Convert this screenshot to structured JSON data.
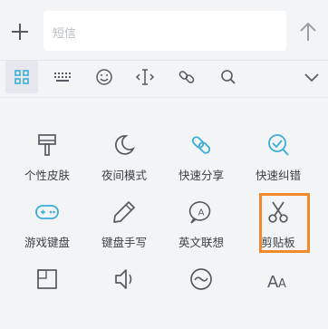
{
  "input": {
    "placeholder": "短信"
  },
  "toolbar": {
    "tools": [
      {
        "icon": "grid-icon",
        "active": true
      },
      {
        "icon": "keyboard-icon"
      },
      {
        "icon": "emoji-icon"
      },
      {
        "icon": "text-cursor-icon"
      },
      {
        "icon": "link-icon"
      },
      {
        "icon": "search-icon"
      },
      {
        "icon": "chevron-down-icon"
      }
    ]
  },
  "grid": {
    "items": [
      {
        "label": "个性皮肤",
        "icon": "paint-brush-icon"
      },
      {
        "label": "夜间模式",
        "icon": "moon-icon"
      },
      {
        "label": "快速分享",
        "icon": "share-link-icon"
      },
      {
        "label": "快速纠错",
        "icon": "magnify-check-icon"
      },
      {
        "label": "游戏键盘",
        "icon": "gamepad-icon"
      },
      {
        "label": "键盘手写",
        "icon": "pencil-icon"
      },
      {
        "label": "英文联想",
        "icon": "letter-a-bubble-icon"
      },
      {
        "label": "剪贴板",
        "icon": "scissors-icon"
      },
      {
        "label": "",
        "icon": "layout-icon"
      },
      {
        "label": "",
        "icon": "speaker-icon"
      },
      {
        "label": "",
        "icon": "wave-icon"
      },
      {
        "label": "",
        "icon": "font-size-icon"
      }
    ]
  },
  "colors": {
    "accent": "#3aaed8",
    "highlight": "#f28a2c",
    "icon": "#555a61"
  }
}
